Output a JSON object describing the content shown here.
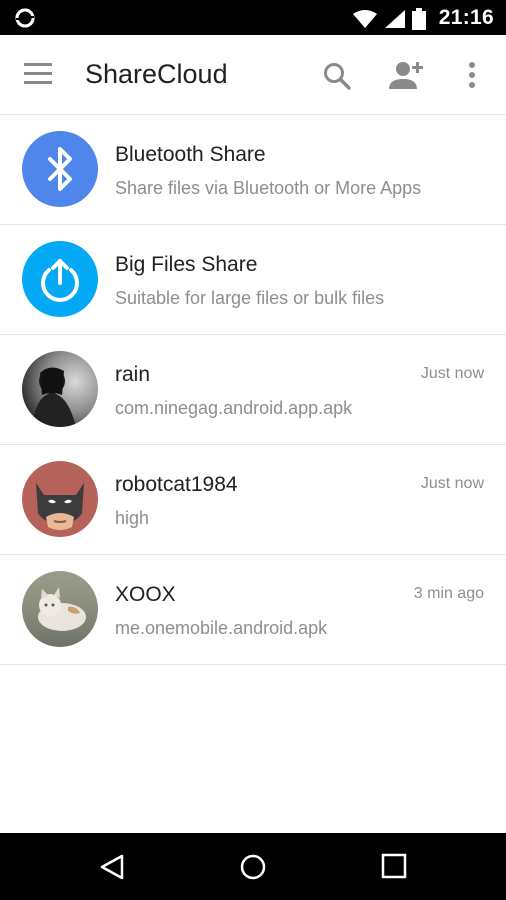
{
  "status_bar": {
    "time": "21:16",
    "icons": [
      "sync-notification-icon",
      "wifi-icon",
      "signal-icon",
      "battery-icon"
    ]
  },
  "toolbar": {
    "title": "ShareCloud",
    "icons": [
      "menu-icon",
      "search-icon",
      "add-user-icon",
      "more-vert-icon"
    ]
  },
  "share_options": [
    {
      "name": "Bluetooth Share",
      "subtitle": "Share files via Bluetooth or More Apps",
      "icon": "bluetooth-icon",
      "color": "#4f86ec"
    },
    {
      "name": "Big Files Share",
      "subtitle": "Suitable for large files or bulk files",
      "icon": "upload-power-icon",
      "color": "#03a9f4"
    }
  ],
  "recent_shares": [
    {
      "name": "rain",
      "subtitle": "com.ninegag.android.app.apk",
      "time": "Just now",
      "avatar": "photo-avatar"
    },
    {
      "name": "robotcat1984",
      "subtitle": "high",
      "time": "Just now",
      "avatar": "batman-mask-avatar",
      "avatar_color": "#b5625b"
    },
    {
      "name": "XOOX",
      "subtitle": "me.onemobile.android.apk",
      "time": "3 min ago",
      "avatar": "cat-photo-avatar"
    }
  ],
  "nav_bar": {
    "icons": [
      "back-icon",
      "home-icon",
      "recents-icon"
    ]
  },
  "colors": {
    "status_bar_bg": "#000000",
    "divider": "#e6e6e6",
    "primary_text": "#212121",
    "secondary_text": "#8e8e8e"
  }
}
